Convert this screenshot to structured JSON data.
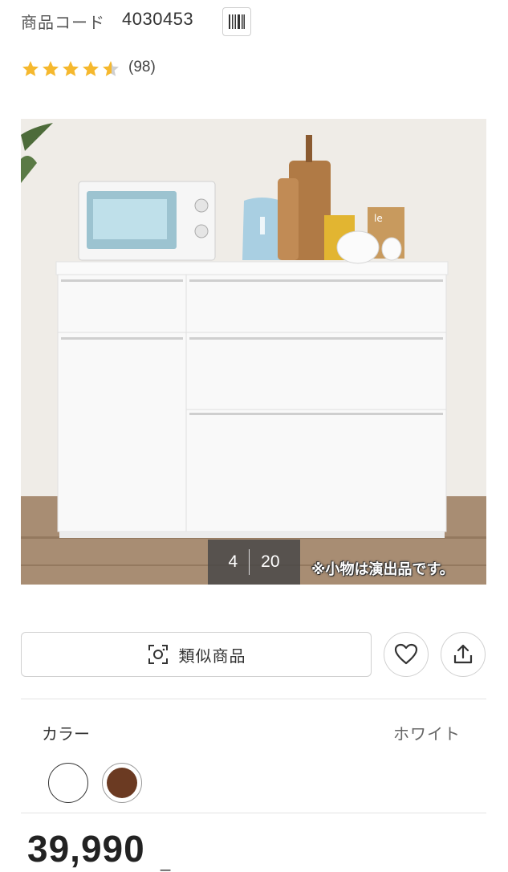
{
  "product": {
    "code_label": "商品コード",
    "code_value": "4030453",
    "rating_value": 4.5,
    "review_count": "(98)"
  },
  "gallery": {
    "current": "4",
    "total": "20",
    "caption": "※小物は演出品です。"
  },
  "actions": {
    "similar_label": "類似商品"
  },
  "color": {
    "title": "カラー",
    "selected": "ホワイト",
    "options": [
      {
        "name": "white",
        "hex": "#ffffff"
      },
      {
        "name": "brown",
        "hex": "#6b3a22"
      }
    ]
  },
  "price": {
    "amount": "39,990",
    "suffix": "_"
  },
  "theme": {
    "star_color": "#f5b82e",
    "accent_text": "#333333"
  }
}
